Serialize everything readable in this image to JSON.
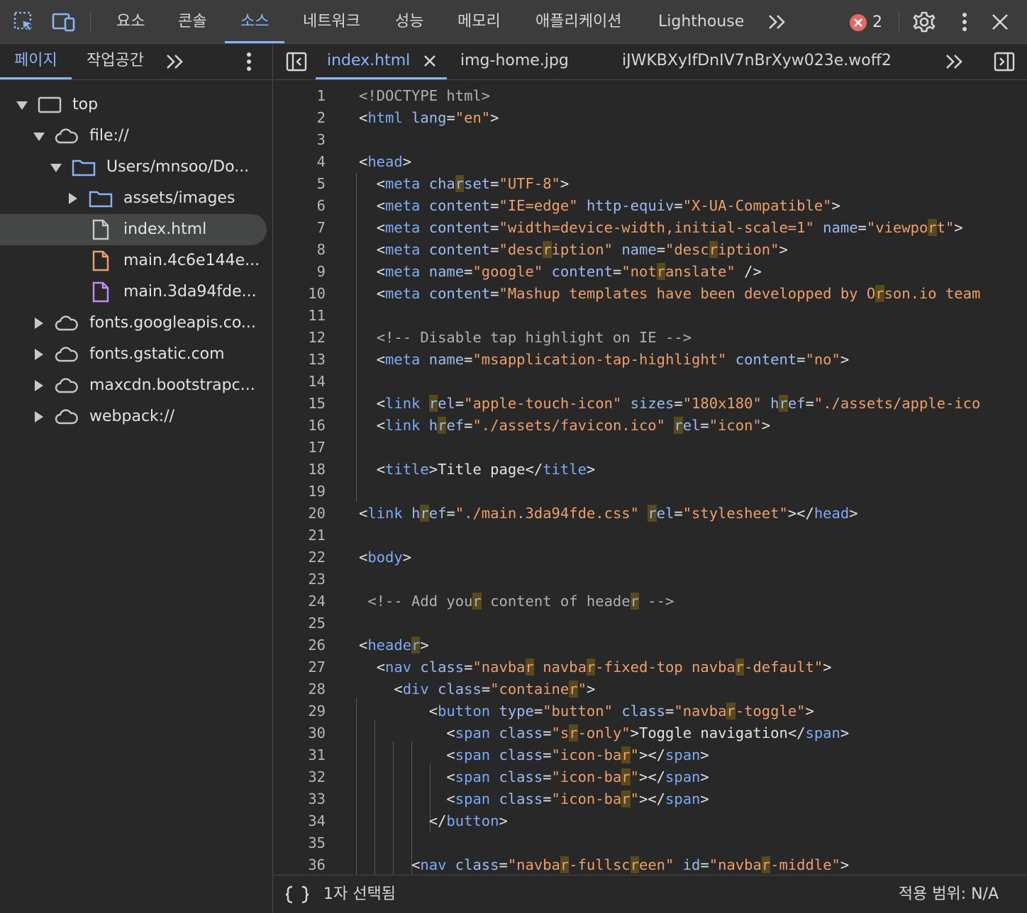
{
  "toolbar": {
    "tabs": [
      "요소",
      "콘솔",
      "소스",
      "네트워크",
      "성능",
      "메모리",
      "애플리케이션",
      "Lighthouse"
    ],
    "active_tab": "소스",
    "more_icon": "chevron-double-right-icon",
    "error_count": "2",
    "error_color": "#e46962",
    "accent_color": "#8ab4f8"
  },
  "navigator": {
    "tabs": [
      "페이지",
      "작업공간"
    ],
    "active_tab": "페이지",
    "tree": [
      {
        "label": "top",
        "icon": "frame-icon",
        "expanded": true
      },
      {
        "label": "file://",
        "icon": "cloud-icon",
        "expanded": true
      },
      {
        "label": "Users/mnsoo/Do...",
        "icon": "folder-icon",
        "expanded": true
      },
      {
        "label": "assets/images",
        "icon": "folder-icon",
        "expanded": false
      },
      {
        "label": "index.html",
        "icon": "file-icon",
        "selected": true
      },
      {
        "label": "main.4c6e144e...",
        "icon": "file-js-icon"
      },
      {
        "label": "main.3da94fde...",
        "icon": "file-css-icon"
      },
      {
        "label": "fonts.googleapis.co...",
        "icon": "cloud-icon",
        "expanded": false
      },
      {
        "label": "fonts.gstatic.com",
        "icon": "cloud-icon",
        "expanded": false
      },
      {
        "label": "maxcdn.bootstrapc...",
        "icon": "cloud-icon",
        "expanded": false
      },
      {
        "label": "webpack://",
        "icon": "cloud-icon",
        "expanded": false
      }
    ]
  },
  "editor": {
    "tabs": [
      "index.html",
      "img-home.jpg",
      "iJWKBXyIfDnIV7nBrXyw023e.woff2"
    ],
    "active_tab": "index.html",
    "lines": [
      [
        [
          "doc",
          "<!DOCTYPE html>"
        ]
      ],
      [
        [
          "p",
          "<"
        ],
        [
          "tag",
          "html"
        ],
        [
          "t",
          " "
        ],
        [
          "attr",
          "lang"
        ],
        [
          "p",
          "="
        ],
        [
          "val",
          "\"en\""
        ],
        [
          "p",
          ">"
        ]
      ],
      [],
      [
        [
          "p",
          "<"
        ],
        [
          "tag",
          "head"
        ],
        [
          "p",
          ">"
        ]
      ],
      [
        [
          "t",
          "  "
        ],
        [
          "p",
          "<"
        ],
        [
          "tag",
          "meta"
        ],
        [
          "t",
          " "
        ],
        [
          "attr",
          "cha"
        ],
        [
          "hattr",
          "r"
        ],
        [
          "attr",
          "set"
        ],
        [
          "p",
          "="
        ],
        [
          "val",
          "\"UTF-8\""
        ],
        [
          "p",
          ">"
        ]
      ],
      [
        [
          "t",
          "  "
        ],
        [
          "p",
          "<"
        ],
        [
          "tag",
          "meta"
        ],
        [
          "t",
          " "
        ],
        [
          "attr",
          "content"
        ],
        [
          "p",
          "="
        ],
        [
          "val",
          "\"IE=edge\""
        ],
        [
          "t",
          " "
        ],
        [
          "attr",
          "http-equiv"
        ],
        [
          "p",
          "="
        ],
        [
          "val",
          "\"X-UA-Compatible\""
        ],
        [
          "p",
          ">"
        ]
      ],
      [
        [
          "t",
          "  "
        ],
        [
          "p",
          "<"
        ],
        [
          "tag",
          "meta"
        ],
        [
          "t",
          " "
        ],
        [
          "attr",
          "content"
        ],
        [
          "p",
          "="
        ],
        [
          "val",
          "\"width=device-width,initial-scale=1\""
        ],
        [
          "t",
          " "
        ],
        [
          "attr",
          "name"
        ],
        [
          "p",
          "="
        ],
        [
          "val",
          "\"viewpo"
        ],
        [
          "hval",
          "r"
        ],
        [
          "val",
          "t\""
        ],
        [
          "p",
          ">"
        ]
      ],
      [
        [
          "t",
          "  "
        ],
        [
          "p",
          "<"
        ],
        [
          "tag",
          "meta"
        ],
        [
          "t",
          " "
        ],
        [
          "attr",
          "content"
        ],
        [
          "p",
          "="
        ],
        [
          "val",
          "\"desc"
        ],
        [
          "hval",
          "r"
        ],
        [
          "val",
          "iption\""
        ],
        [
          "t",
          " "
        ],
        [
          "attr",
          "name"
        ],
        [
          "p",
          "="
        ],
        [
          "val",
          "\"desc"
        ],
        [
          "hval",
          "r"
        ],
        [
          "val",
          "iption\""
        ],
        [
          "p",
          ">"
        ]
      ],
      [
        [
          "t",
          "  "
        ],
        [
          "p",
          "<"
        ],
        [
          "tag",
          "meta"
        ],
        [
          "t",
          " "
        ],
        [
          "attr",
          "name"
        ],
        [
          "p",
          "="
        ],
        [
          "val",
          "\"google\""
        ],
        [
          "t",
          " "
        ],
        [
          "attr",
          "content"
        ],
        [
          "p",
          "="
        ],
        [
          "val",
          "\"not"
        ],
        [
          "hval",
          "r"
        ],
        [
          "val",
          "anslate\""
        ],
        [
          "t",
          " "
        ],
        [
          "p",
          "/>"
        ]
      ],
      [
        [
          "t",
          "  "
        ],
        [
          "p",
          "<"
        ],
        [
          "tag",
          "meta"
        ],
        [
          "t",
          " "
        ],
        [
          "attr",
          "content"
        ],
        [
          "p",
          "="
        ],
        [
          "val",
          "\"Mashup templates have been developped by O"
        ],
        [
          "hval",
          "r"
        ],
        [
          "val",
          "son.io team"
        ]
      ],
      [],
      [
        [
          "t",
          "  "
        ],
        [
          "cmt",
          "<!-- Disable tap highlight on IE -->"
        ]
      ],
      [
        [
          "t",
          "  "
        ],
        [
          "p",
          "<"
        ],
        [
          "tag",
          "meta"
        ],
        [
          "t",
          " "
        ],
        [
          "attr",
          "name"
        ],
        [
          "p",
          "="
        ],
        [
          "val",
          "\"msapplication-tap-highlight\""
        ],
        [
          "t",
          " "
        ],
        [
          "attr",
          "content"
        ],
        [
          "p",
          "="
        ],
        [
          "val",
          "\"no\""
        ],
        [
          "p",
          ">"
        ]
      ],
      [],
      [
        [
          "t",
          "  "
        ],
        [
          "p",
          "<"
        ],
        [
          "tag",
          "link"
        ],
        [
          "t",
          " "
        ],
        [
          "hattr",
          "r"
        ],
        [
          "attr",
          "el"
        ],
        [
          "p",
          "="
        ],
        [
          "val",
          "\"apple-touch-icon\""
        ],
        [
          "t",
          " "
        ],
        [
          "attr",
          "sizes"
        ],
        [
          "p",
          "="
        ],
        [
          "val",
          "\"180x180\""
        ],
        [
          "t",
          " "
        ],
        [
          "attr",
          "h"
        ],
        [
          "hattr",
          "r"
        ],
        [
          "attr",
          "ef"
        ],
        [
          "p",
          "="
        ],
        [
          "val",
          "\"./assets/apple-ico"
        ]
      ],
      [
        [
          "t",
          "  "
        ],
        [
          "p",
          "<"
        ],
        [
          "tag",
          "link"
        ],
        [
          "t",
          " "
        ],
        [
          "attr",
          "h"
        ],
        [
          "hattr",
          "r"
        ],
        [
          "attr",
          "ef"
        ],
        [
          "p",
          "="
        ],
        [
          "val",
          "\"./assets/favicon.ico\""
        ],
        [
          "t",
          " "
        ],
        [
          "hattr",
          "r"
        ],
        [
          "attr",
          "el"
        ],
        [
          "p",
          "="
        ],
        [
          "val",
          "\"icon\""
        ],
        [
          "p",
          ">"
        ]
      ],
      [],
      [
        [
          "t",
          "  "
        ],
        [
          "p",
          "<"
        ],
        [
          "tag",
          "title"
        ],
        [
          "p",
          ">"
        ],
        [
          "t",
          "Title page"
        ],
        [
          "p",
          "</"
        ],
        [
          "tag",
          "title"
        ],
        [
          "p",
          ">"
        ]
      ],
      [],
      [
        [
          "p",
          "<"
        ],
        [
          "tag",
          "link"
        ],
        [
          "t",
          " "
        ],
        [
          "attr",
          "h"
        ],
        [
          "hattr",
          "r"
        ],
        [
          "attr",
          "ef"
        ],
        [
          "p",
          "="
        ],
        [
          "val",
          "\"./main.3da94fde.css\""
        ],
        [
          "t",
          " "
        ],
        [
          "hattr",
          "r"
        ],
        [
          "attr",
          "el"
        ],
        [
          "p",
          "="
        ],
        [
          "val",
          "\"stylesheet\""
        ],
        [
          "p",
          "></"
        ],
        [
          "tag",
          "head"
        ],
        [
          "p",
          ">"
        ]
      ],
      [],
      [
        [
          "p",
          "<"
        ],
        [
          "tag",
          "body"
        ],
        [
          "p",
          ">"
        ]
      ],
      [],
      [
        [
          "t",
          " "
        ],
        [
          "cmt",
          "<!-- Add you"
        ],
        [
          "hcmt",
          "r"
        ],
        [
          "cmt",
          " content of heade"
        ],
        [
          "hcmt",
          "r"
        ],
        [
          "cmt",
          " -->"
        ]
      ],
      [],
      [
        [
          "p",
          "<"
        ],
        [
          "tag",
          "heade"
        ],
        [
          "htag",
          "r"
        ],
        [
          "p",
          ">"
        ]
      ],
      [
        [
          "t",
          "  "
        ],
        [
          "p",
          "<"
        ],
        [
          "tag",
          "nav"
        ],
        [
          "t",
          " "
        ],
        [
          "attr",
          "class"
        ],
        [
          "p",
          "="
        ],
        [
          "val",
          "\"navba"
        ],
        [
          "hval",
          "r"
        ],
        [
          "val",
          " navba"
        ],
        [
          "hval",
          "r"
        ],
        [
          "val",
          "-fixed-top navba"
        ],
        [
          "hval",
          "r"
        ],
        [
          "val",
          "-default\""
        ],
        [
          "p",
          ">"
        ]
      ],
      [
        [
          "t",
          "    "
        ],
        [
          "p",
          "<"
        ],
        [
          "tag",
          "div"
        ],
        [
          "t",
          " "
        ],
        [
          "attr",
          "class"
        ],
        [
          "p",
          "="
        ],
        [
          "val",
          "\"containe"
        ],
        [
          "hval",
          "r"
        ],
        [
          "val",
          "\""
        ],
        [
          "p",
          ">"
        ]
      ],
      [
        [
          "t",
          "        "
        ],
        [
          "p",
          "<"
        ],
        [
          "tag",
          "button"
        ],
        [
          "t",
          " "
        ],
        [
          "attr",
          "type"
        ],
        [
          "p",
          "="
        ],
        [
          "val",
          "\"button\""
        ],
        [
          "t",
          " "
        ],
        [
          "attr",
          "class"
        ],
        [
          "p",
          "="
        ],
        [
          "val",
          "\"navba"
        ],
        [
          "hval",
          "r"
        ],
        [
          "val",
          "-toggle\""
        ],
        [
          "p",
          ">"
        ]
      ],
      [
        [
          "t",
          "          "
        ],
        [
          "p",
          "<"
        ],
        [
          "tag",
          "span"
        ],
        [
          "t",
          " "
        ],
        [
          "attr",
          "class"
        ],
        [
          "p",
          "="
        ],
        [
          "val",
          "\"s"
        ],
        [
          "hval",
          "r"
        ],
        [
          "val",
          "-only\""
        ],
        [
          "p",
          ">"
        ],
        [
          "t",
          "Toggle navigation"
        ],
        [
          "p",
          "</"
        ],
        [
          "tag",
          "span"
        ],
        [
          "p",
          ">"
        ]
      ],
      [
        [
          "t",
          "          "
        ],
        [
          "p",
          "<"
        ],
        [
          "tag",
          "span"
        ],
        [
          "t",
          " "
        ],
        [
          "attr",
          "class"
        ],
        [
          "p",
          "="
        ],
        [
          "val",
          "\"icon-ba"
        ],
        [
          "hval",
          "r"
        ],
        [
          "val",
          "\""
        ],
        [
          "p",
          "></"
        ],
        [
          "tag",
          "span"
        ],
        [
          "p",
          ">"
        ]
      ],
      [
        [
          "t",
          "          "
        ],
        [
          "p",
          "<"
        ],
        [
          "tag",
          "span"
        ],
        [
          "t",
          " "
        ],
        [
          "attr",
          "class"
        ],
        [
          "p",
          "="
        ],
        [
          "val",
          "\"icon-ba"
        ],
        [
          "hval",
          "r"
        ],
        [
          "val",
          "\""
        ],
        [
          "p",
          "></"
        ],
        [
          "tag",
          "span"
        ],
        [
          "p",
          ">"
        ]
      ],
      [
        [
          "t",
          "          "
        ],
        [
          "p",
          "<"
        ],
        [
          "tag",
          "span"
        ],
        [
          "t",
          " "
        ],
        [
          "attr",
          "class"
        ],
        [
          "p",
          "="
        ],
        [
          "val",
          "\"icon-ba"
        ],
        [
          "hval",
          "r"
        ],
        [
          "val",
          "\""
        ],
        [
          "p",
          "></"
        ],
        [
          "tag",
          "span"
        ],
        [
          "p",
          ">"
        ]
      ],
      [
        [
          "t",
          "        "
        ],
        [
          "p",
          "</"
        ],
        [
          "tag",
          "button"
        ],
        [
          "p",
          ">"
        ]
      ],
      [],
      [
        [
          "t",
          "      "
        ],
        [
          "p",
          "<"
        ],
        [
          "tag",
          "nav"
        ],
        [
          "t",
          " "
        ],
        [
          "attr",
          "class"
        ],
        [
          "p",
          "="
        ],
        [
          "val",
          "\"navba"
        ],
        [
          "hval",
          "r"
        ],
        [
          "val",
          "-fullsc"
        ],
        [
          "hval",
          "r"
        ],
        [
          "val",
          "een\""
        ],
        [
          "t",
          " "
        ],
        [
          "attr",
          "id"
        ],
        [
          "p",
          "="
        ],
        [
          "val",
          "\"navba"
        ],
        [
          "hval",
          "r"
        ],
        [
          "val",
          "-middle\""
        ],
        [
          "p",
          ">"
        ]
      ]
    ]
  },
  "statusbar": {
    "selection": "1자 선택됨",
    "coverage": "적용 범위: N/A"
  }
}
